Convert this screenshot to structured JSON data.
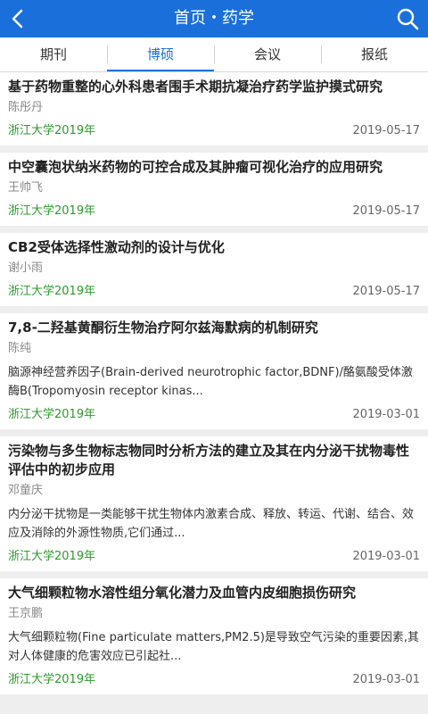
{
  "header": {
    "title": "首页・药学"
  },
  "tabs": [
    {
      "label": "期刊"
    },
    {
      "label": "博硕"
    },
    {
      "label": "会议"
    },
    {
      "label": "报纸"
    }
  ],
  "items": [
    {
      "title": "基于药物重整的心外科患者围手术期抗凝治疗药学监护摸式研究",
      "author": "陈彤丹",
      "abstract": "",
      "source": "浙江大学2019年",
      "date": "2019-05-17"
    },
    {
      "title": "中空囊泡状纳米药物的可控合成及其肿瘤可视化治疗的应用研究",
      "author": "王帅飞",
      "abstract": "",
      "source": "浙江大学2019年",
      "date": "2019-05-17"
    },
    {
      "title": "CB2受体选择性激动剂的设计与优化",
      "author": "谢小雨",
      "abstract": "",
      "source": "浙江大学2019年",
      "date": "2019-05-17"
    },
    {
      "title": "7,8-二羟基黄酮衍生物治疗阿尔兹海默病的机制研究",
      "author": "陈纯",
      "abstract": "脑源神经营养因子(Brain-derived neurotrophic factor,BDNF)/酪氨酸受体激酶B(Tropomyosin receptor kinas...",
      "source": "浙江大学2019年",
      "date": "2019-03-01"
    },
    {
      "title": "污染物与多生物标志物同时分析方法的建立及其在内分泌干扰物毒性评估中的初步应用",
      "author": "邓童庆",
      "abstract": "内分泌干扰物是一类能够干扰生物体内激素合成、释放、转运、代谢、结合、效应及消除的外源性物质,它们通过...",
      "source": "浙江大学2019年",
      "date": "2019-03-01"
    },
    {
      "title": "大气细颗粒物水溶性组分氧化潜力及血管内皮细胞损伤研究",
      "author": "王京鹏",
      "abstract": "大气细颗粒物(Fine particulate matters,PM2.5)是导致空气污染的重要因素,其对人体健康的危害效应已引起社...",
      "source": "浙江大学2019年",
      "date": "2019-03-01"
    }
  ]
}
